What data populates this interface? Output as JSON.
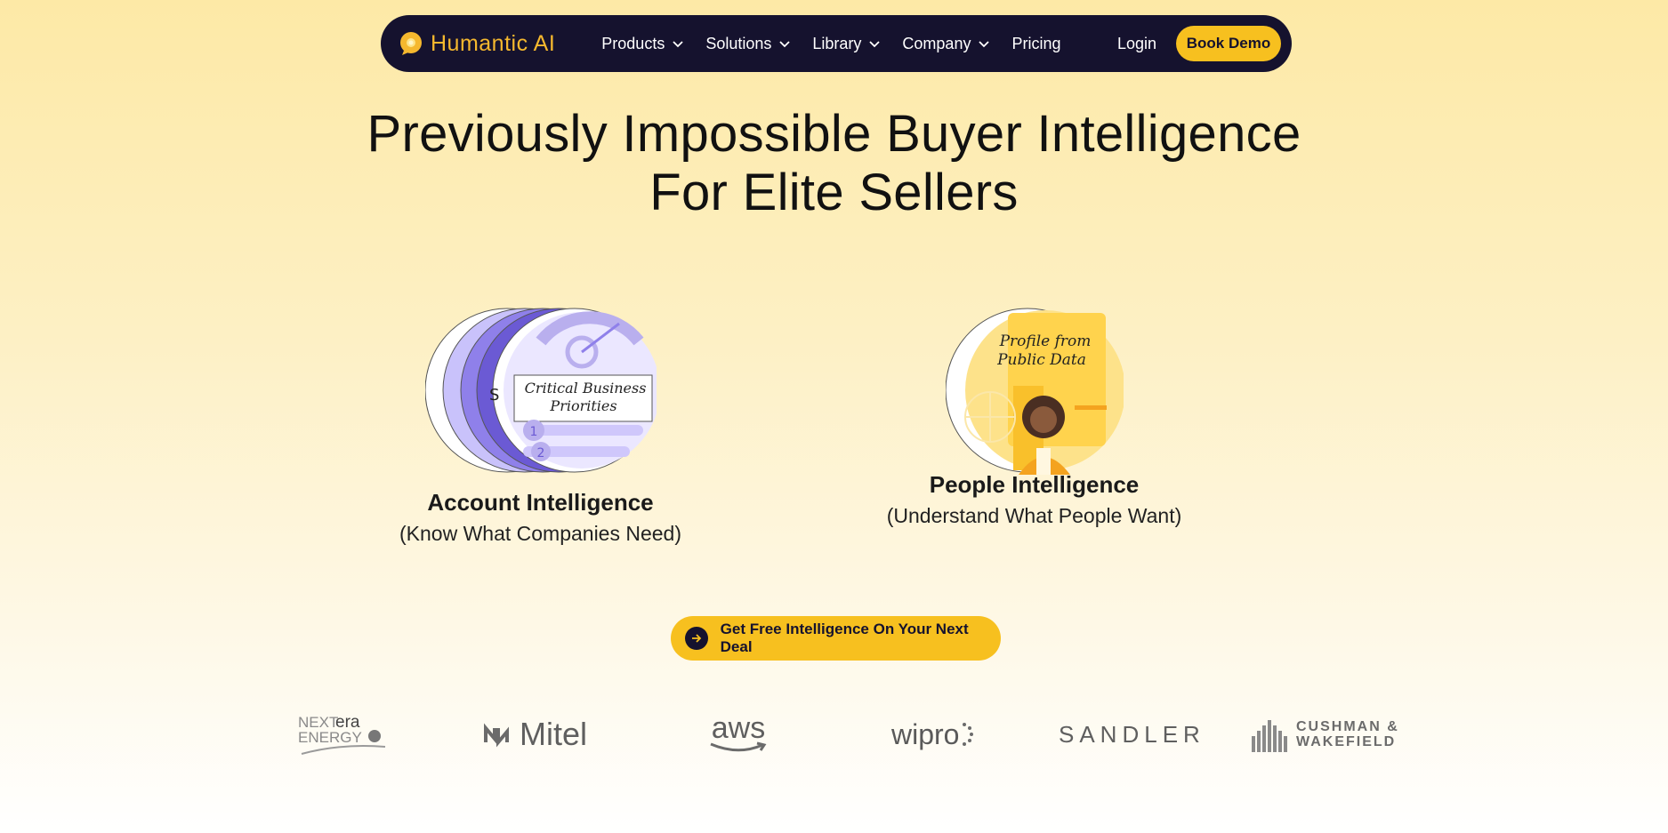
{
  "brand": {
    "name": "Humantic AI",
    "accent": "#f5b82e",
    "nav_bg": "#15122e",
    "button_bg": "#f7c01f"
  },
  "nav": {
    "items": [
      {
        "label": "Products",
        "has_dropdown": true
      },
      {
        "label": "Solutions",
        "has_dropdown": true
      },
      {
        "label": "Library",
        "has_dropdown": true
      },
      {
        "label": "Company",
        "has_dropdown": true
      },
      {
        "label": "Pricing",
        "has_dropdown": false
      }
    ],
    "login_label": "Login",
    "book_demo_label": "Book Demo"
  },
  "hero": {
    "headline_line1": "Previously Impossible Buyer Intelligence",
    "headline_line2": "For Elite Sellers"
  },
  "cards": {
    "account": {
      "title": "Account Intelligence",
      "subtitle": "(Know What Companies Need)",
      "art_text_1": "Critical Business",
      "art_text_2": "Priorities",
      "art_num_1": "1",
      "art_num_2": "2"
    },
    "people": {
      "title": "People Intelligence",
      "subtitle": "(Understand What People Want)",
      "art_text_1": "Profile from",
      "art_text_2": "Public Data"
    }
  },
  "cta": {
    "label": "Get Free Intelligence On Your Next Deal",
    "icon": "arrow-right-icon"
  },
  "clients": [
    {
      "name": "NEXTera ENERGY",
      "line1a": "NEXT",
      "line1b": "era",
      "line2": "ENERGY"
    },
    {
      "name": "Mitel",
      "label": "Mitel"
    },
    {
      "name": "aws",
      "label": "aws"
    },
    {
      "name": "wipro",
      "label": "wipro"
    },
    {
      "name": "SANDLER",
      "label": "SANDLER"
    },
    {
      "name": "CUSHMAN & WAKEFIELD",
      "line1": "CUSHMAN &",
      "line2": "WAKEFIELD"
    }
  ]
}
